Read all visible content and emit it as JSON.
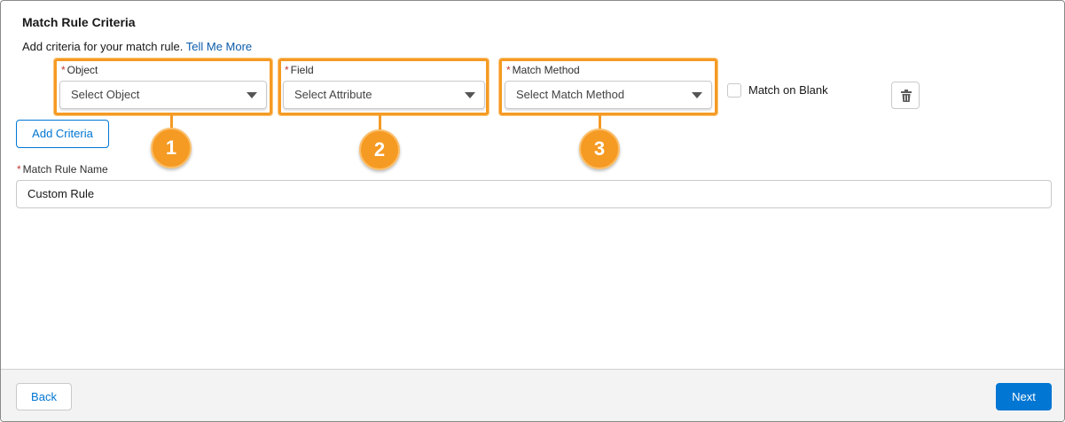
{
  "header": {
    "title": "Match Rule Criteria",
    "subtitle": "Add criteria for your match rule.",
    "link_label": "Tell Me More"
  },
  "criteria": {
    "object": {
      "label": "Object",
      "required_mark": "*",
      "placeholder": "Select Object",
      "callout": "1"
    },
    "field": {
      "label": "Field",
      "required_mark": "*",
      "placeholder": "Select Attribute",
      "callout": "2"
    },
    "match_method": {
      "label": "Match Method",
      "required_mark": "*",
      "placeholder": "Select Match Method",
      "callout": "3"
    },
    "match_on_blank_label": "Match on Blank",
    "match_on_blank_checked": false
  },
  "actions": {
    "add_criteria_label": "Add Criteria"
  },
  "rule_name": {
    "label": "Match Rule Name",
    "required_mark": "*",
    "value": "Custom Rule"
  },
  "footer": {
    "back_label": "Back",
    "next_label": "Next"
  },
  "icons": {
    "delete": "trash-icon",
    "select_caret": "caret-down-icon"
  },
  "colors": {
    "accent": "#0176d3",
    "highlight": "#f59a23",
    "required": "#c23934"
  }
}
